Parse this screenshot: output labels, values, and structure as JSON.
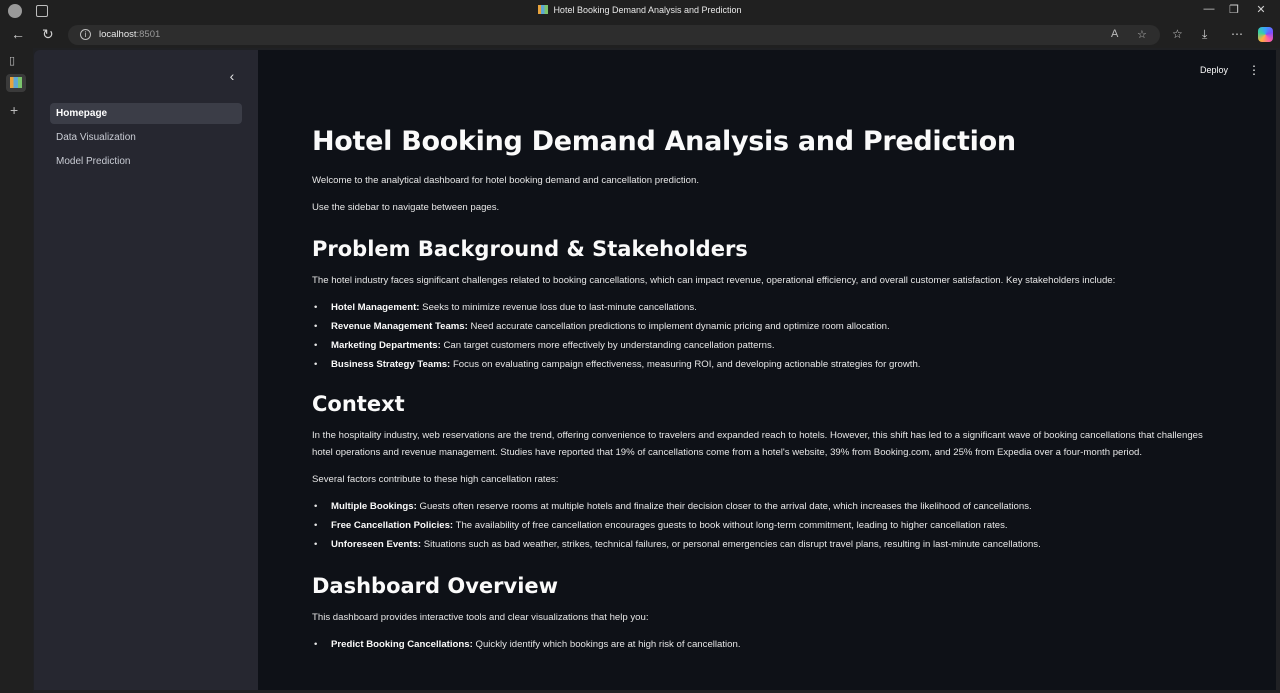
{
  "window": {
    "title": "Hotel Booking Demand Analysis and Prediction"
  },
  "address_bar": {
    "host": "localhost",
    "port": ":8501"
  },
  "header": {
    "deploy_label": "Deploy"
  },
  "sidebar": {
    "items": [
      {
        "label": "Homepage",
        "active": true
      },
      {
        "label": "Data Visualization",
        "active": false
      },
      {
        "label": "Model Prediction",
        "active": false
      }
    ]
  },
  "main": {
    "title": "Hotel Booking Demand Analysis and Prediction",
    "intro": [
      "Welcome to the analytical dashboard for hotel booking demand and cancellation prediction.",
      "Use the sidebar to navigate between pages."
    ],
    "problem": {
      "heading": "Problem Background & Stakeholders",
      "text": "The hotel industry faces significant challenges related to booking cancellations, which can impact revenue, operational efficiency, and overall customer satisfaction. Key stakeholders include:",
      "bullets": [
        {
          "term": "Hotel Management:",
          "text": "Seeks to minimize revenue loss due to last-minute cancellations."
        },
        {
          "term": "Revenue Management Teams:",
          "text": "Need accurate cancellation predictions to implement dynamic pricing and optimize room allocation."
        },
        {
          "term": "Marketing Departments:",
          "text": "Can target customers more effectively by understanding cancellation patterns."
        },
        {
          "term": "Business Strategy Teams:",
          "text": "Focus on evaluating campaign effectiveness, measuring ROI, and developing actionable strategies for growth."
        }
      ]
    },
    "context": {
      "heading": "Context",
      "text": "In the hospitality industry, web reservations are the trend, offering convenience to travelers and expanded reach to hotels. However, this shift has led to a significant wave of booking cancellations that challenges hotel operations and revenue management. Studies have reported that 19% of cancellations come from a hotel's website, 39% from Booking.com, and 25% from Expedia over a four-month period.",
      "factors_intro": "Several factors contribute to these high cancellation rates:",
      "bullets": [
        {
          "term": "Multiple Bookings:",
          "text": "Guests often reserve rooms at multiple hotels and finalize their decision closer to the arrival date, which increases the likelihood of cancellations."
        },
        {
          "term": "Free Cancellation Policies:",
          "text": "The availability of free cancellation encourages guests to book without long-term commitment, leading to higher cancellation rates."
        },
        {
          "term": "Unforeseen Events:",
          "text": "Situations such as bad weather, strikes, technical failures, or personal emergencies can disrupt travel plans, resulting in last-minute cancellations."
        }
      ]
    },
    "overview": {
      "heading": "Dashboard Overview",
      "text": "This dashboard provides interactive tools and clear visualizations that help you:",
      "bullets": [
        {
          "term": "Predict Booking Cancellations:",
          "text": "Quickly identify which bookings are at high risk of cancellation."
        }
      ]
    }
  }
}
